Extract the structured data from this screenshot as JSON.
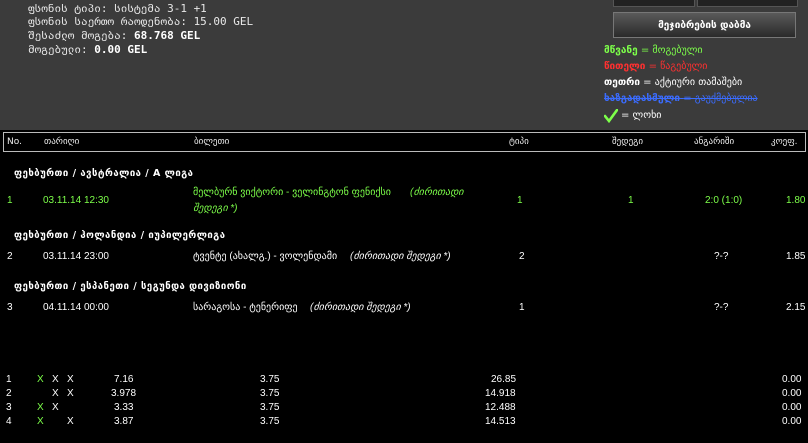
{
  "info": {
    "line1": "ფსონის ტიპი: სისტემა 3-1 +1",
    "line2": "ფსონის საერთო რაოდენობა: 15.00 GEL",
    "line3_label": "შესაძლო მოგება:",
    "line3_value": "68.768 GEL",
    "line4_label": "მოგებული:",
    "line4_value": "0.00 GEL"
  },
  "print_button": "მეჯიბრების დაბმა",
  "legend": {
    "green_key": "მწვანე",
    "green_val": "= მოგებული",
    "red_key": "წითელი",
    "red_val": "= წაგებული",
    "white_key": "თეთრი",
    "white_val": "= აქტიური თამაშები",
    "blue_key": "ხაზგადასმული",
    "blue_val": "= გაუქმებულია",
    "check_val": "= ლოხი"
  },
  "colors": {
    "green": "#7dff4a",
    "red": "#ff3030",
    "blue": "#3b6cff",
    "header_bg": "#3b3b3b"
  },
  "headers": {
    "no": "No.",
    "date": "თარიღი",
    "ticket": "ბილეთი",
    "type": "ტიპი",
    "result": "შედეგი",
    "score": "ანგარიში",
    "coef": "კოეფ."
  },
  "groups": [
    "ფეხბურთი / ავსტრალია / A ლიგა",
    "ფეხბურთი / ჰოლანდია / იუპილერლიგა",
    "ფეხბურთი / ესპანეთი / სეგუნდა დივიზიონი"
  ],
  "bets": [
    {
      "no": "1",
      "date": "03.11.14 12:30",
      "match": "მელბურნ ვიქტორი - ველინგტონ ფენიქსი",
      "match2": "(ძირითადი",
      "match3": "შედეგი *)",
      "type": "1",
      "result": "1",
      "score": "2:0 (1:0)",
      "coef": "1.80"
    },
    {
      "no": "2",
      "date": "03.11.14 23:00",
      "match": "ტვენტე (ახალგ.) - ვოლენდამი",
      "match2": "(ძირითადი შედეგი *)",
      "type": "2",
      "result": "",
      "score": "?-?",
      "coef": "1.85"
    },
    {
      "no": "3",
      "date": "04.11.14 00:00",
      "match": "სარაგოსა - ტენერიფე",
      "match2": "(ძირითადი შედეგი *)",
      "type": "1",
      "result": "",
      "score": "?-?",
      "coef": "2.15"
    }
  ],
  "systems": [
    {
      "no": "1",
      "x1": "X",
      "x2": "X",
      "x3": "X",
      "coef": "7.16",
      "stake": "3.75",
      "win": "26.85",
      "won": "0.00"
    },
    {
      "no": "2",
      "x1": "",
      "x2": "X",
      "x3": "X",
      "coef": "3.978",
      "stake": "3.75",
      "win": "14.918",
      "won": "0.00"
    },
    {
      "no": "3",
      "x1": "X",
      "x2": "X",
      "x3": "",
      "coef": "3.33",
      "stake": "3.75",
      "win": "12.488",
      "won": "0.00"
    },
    {
      "no": "4",
      "x1": "X",
      "x2": "",
      "x3": "X",
      "coef": "3.87",
      "stake": "3.75",
      "win": "14.513",
      "won": "0.00"
    }
  ]
}
